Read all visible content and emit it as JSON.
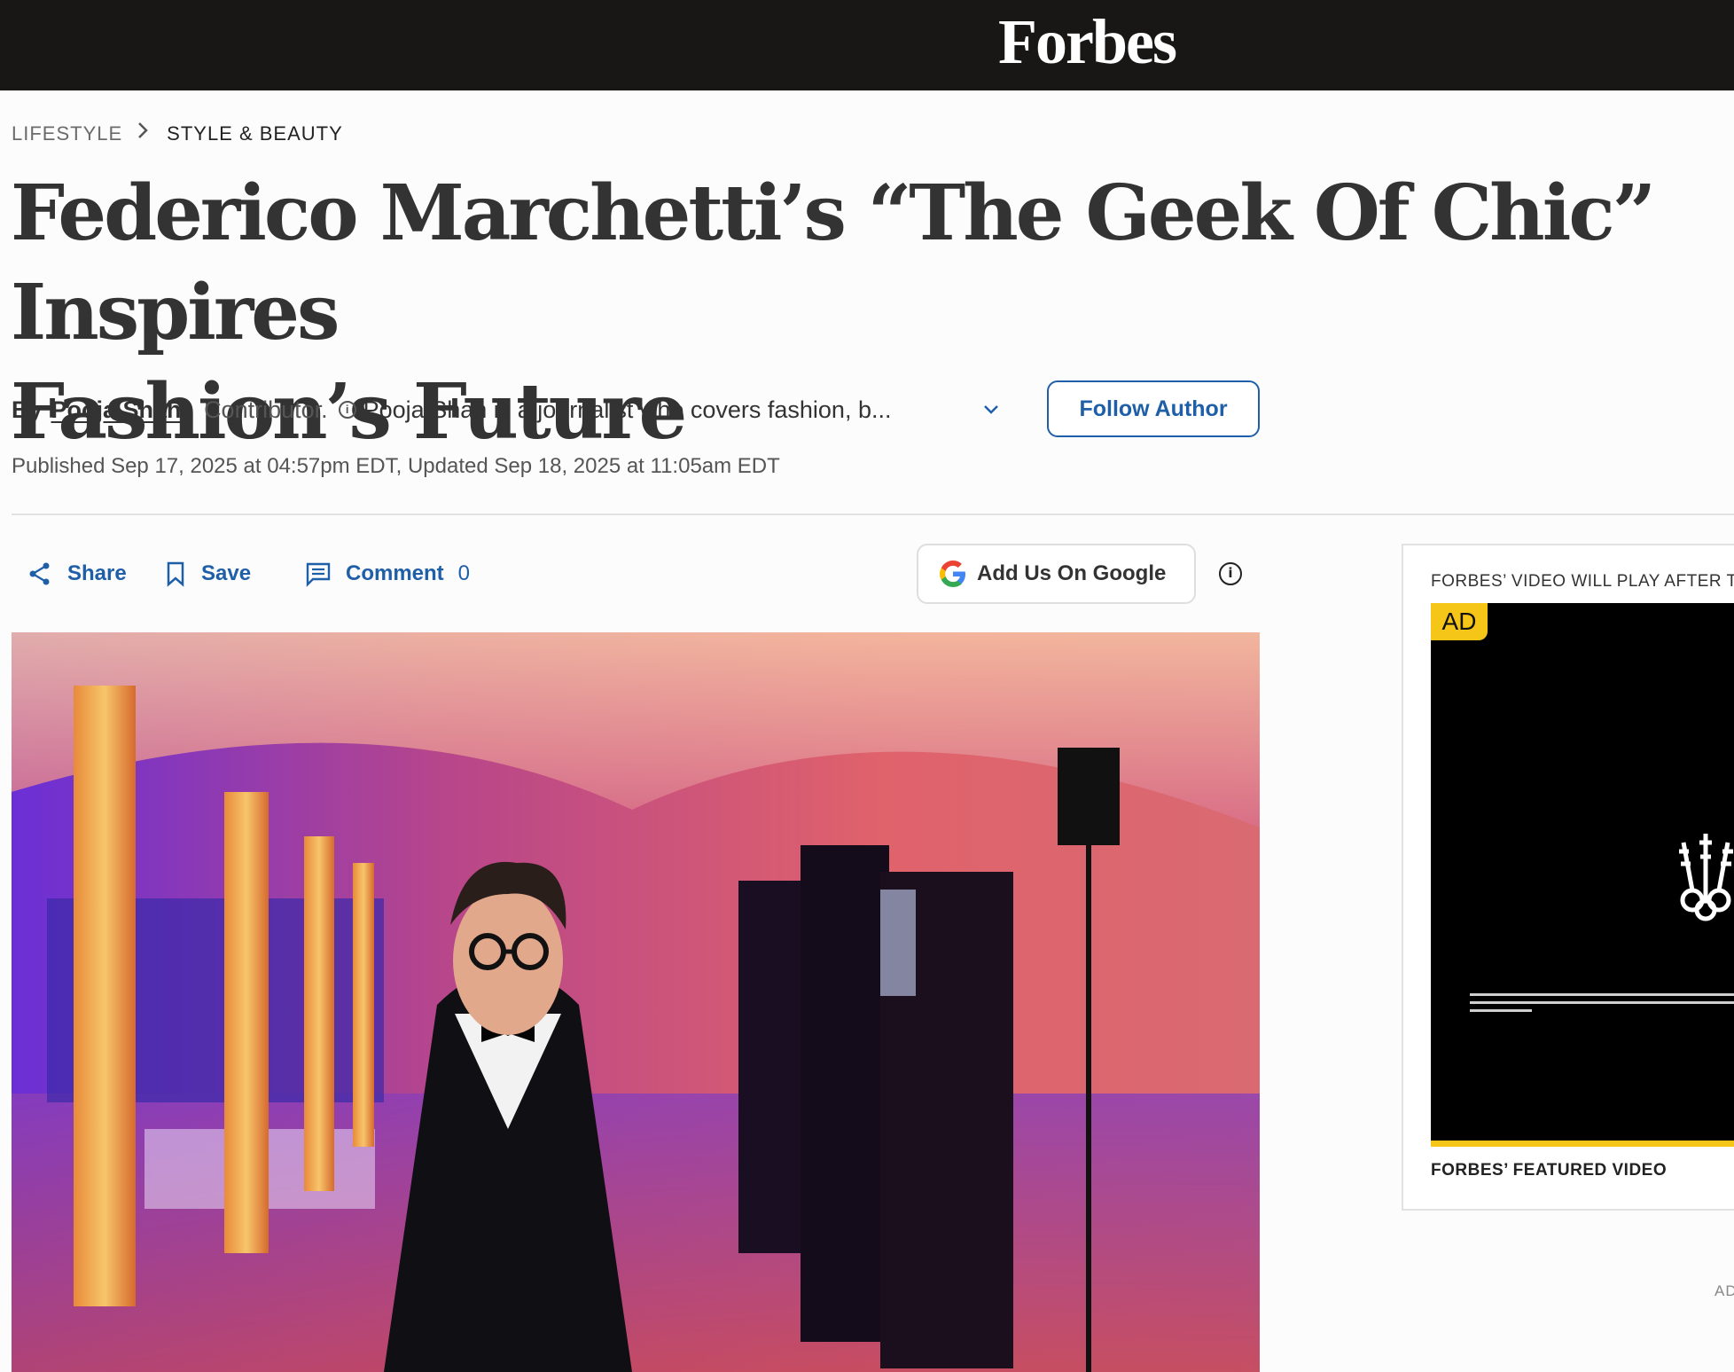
{
  "header": {
    "logo": "Forbes"
  },
  "breadcrumb": {
    "section": "LIFESTYLE",
    "subsection": "STYLE & BEAUTY"
  },
  "article": {
    "headline_line1": "Federico Marchetti’s “The Geek Of Chic” Inspires",
    "headline_line2": "Fashion’s Future",
    "by_label": "By",
    "author": "Pooja Shah",
    "role": "Contributor.",
    "bio": "Pooja Shah is a journalist who covers fashion, b...",
    "follow_label": "Follow Author",
    "published": "Published Sep 17, 2025 at 04:57pm EDT, Updated Sep 18, 2025 at 11:05am EDT"
  },
  "actions": {
    "share": "Share",
    "save": "Save",
    "comment": "Comment",
    "comment_count": "0",
    "google_label": "Add Us On Google"
  },
  "video": {
    "label": "FORBES’ VIDEO WILL PLAY AFTER THIS AD",
    "ad_badge": "AD",
    "featured_label": "FORBES’ FEATURED VIDEO",
    "side_label": "AD"
  },
  "colors": {
    "topbar": "#181716",
    "link_blue": "#1f5fa8",
    "ad_yellow": "#f5c518"
  },
  "icons": [
    "share-icon",
    "bookmark-icon",
    "comment-icon",
    "google-logo-icon",
    "info-icon",
    "chevron-down-icon",
    "chevron-right-icon",
    "ubs-keys-logo-icon"
  ]
}
